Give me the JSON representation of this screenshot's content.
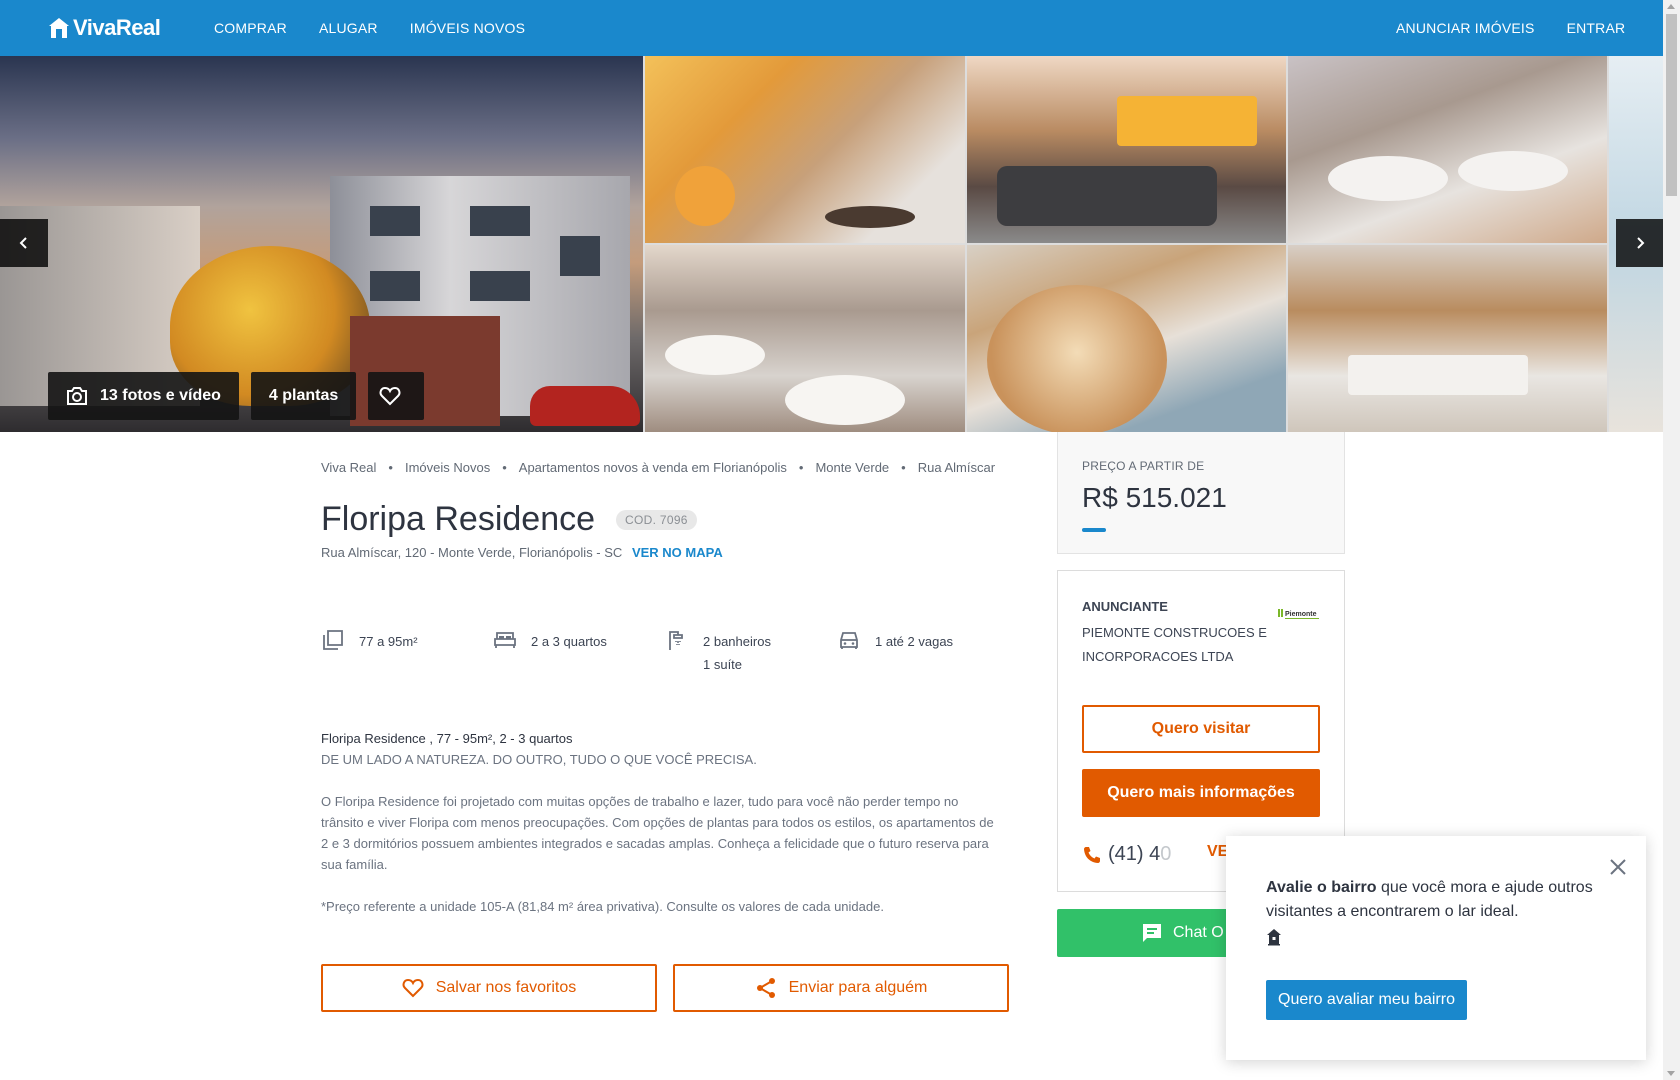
{
  "header": {
    "logo_text": "VivaReal",
    "nav_left": [
      "COMPRAR",
      "ALUGAR",
      "IMÓVEIS NOVOS"
    ],
    "nav_right": [
      "ANUNCIAR IMÓVEIS",
      "ENTRAR"
    ]
  },
  "gallery": {
    "photos_label": "13 fotos e vídeo",
    "plans_label": "4 plantas",
    "icons": {
      "prev": "chevron-left-icon",
      "next": "chevron-right-icon",
      "camera": "camera-icon",
      "favorite": "heart-icon"
    }
  },
  "breadcrumb": [
    "Viva Real",
    "Imóveis Novos",
    "Apartamentos novos à venda em Florianópolis",
    "Monte Verde",
    "Rua Almíscar"
  ],
  "listing": {
    "title": "Floripa Residence",
    "code": "COD. 7096",
    "address": "Rua Almíscar, 120 - Monte Verde, Florianópolis - SC",
    "map_link": "VER NO MAPA"
  },
  "features": {
    "area": "77 a 95m²",
    "bedrooms": "2 a 3 quartos",
    "bathrooms": "2 banheiros",
    "suites": "1 suíte",
    "parking": "1 até 2 vagas"
  },
  "description": {
    "title": "Floripa Residence , 77 - 95m², 2 - 3 quartos",
    "tagline": "DE UM LADO A NATUREZA. DO OUTRO, TUDO O QUE VOCÊ PRECISA.",
    "body": "O Floripa Residence foi projetado com muitas opções de trabalho e lazer, tudo para você não perder tempo no trânsito e viver Floripa com menos preocupações. Com opções de plantas para todos os estilos, os apartamentos de 2 e 3 dormitórios possuem ambientes integrados e sacadas amplas. Conheça a felicidade que o futuro reserva para sua família.",
    "note": "*Preço referente a unidade 105-A (81,84 m² área privativa). Consulte os valores de cada unidade."
  },
  "actions": {
    "save": "Salvar nos favoritos",
    "share": "Enviar para alguém"
  },
  "price": {
    "label": "PREÇO A PARTIR DE",
    "value": "R$ 515.021"
  },
  "advertiser": {
    "label": "ANUNCIANTE",
    "name": "PIEMONTE CONSTRUCOES E INCORPORACOES LTDA",
    "logo_text": "Piemonte",
    "visit_button": "Quero visitar",
    "info_button": "Quero mais informações",
    "phone_visible": "(41) 4",
    "phone_faded": "0",
    "phone_more": "VE"
  },
  "chat": {
    "label": "Chat O"
  },
  "popup": {
    "bold": "Avalie o bairro",
    "text": " que você mora e ajude outros visitantes a encontrarem o lar ideal.",
    "button": "Quero avaliar meu bairro"
  },
  "colors": {
    "brand_blue": "#1a88cc",
    "orange": "#e15a00",
    "green": "#31c169"
  }
}
